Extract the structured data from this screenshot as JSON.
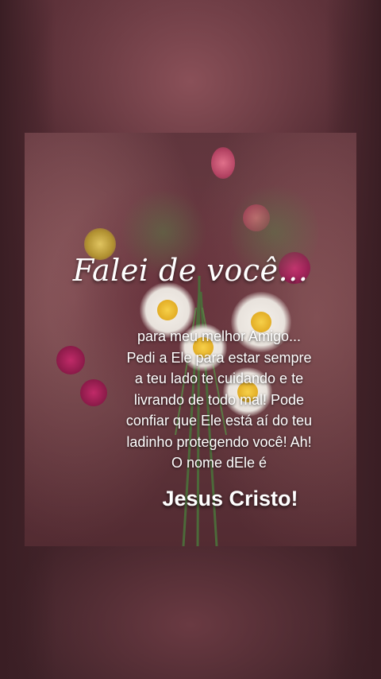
{
  "image": {
    "subject": "flower-bouquet",
    "colors": {
      "background": "#4a2a30",
      "card": "#7e4a50",
      "daisy_petal": "#f4f0ea",
      "daisy_center": "#e8b828",
      "bloom": "#b02a5a",
      "text": "#ffffff"
    }
  },
  "message": {
    "headline": "Falei de você...",
    "lines": [
      "para meu melhor Amigo...",
      "Pedi a Ele para estar sempre",
      "a teu lado te cuidando e te",
      "livrando de todo mal! Pode",
      "confiar que Ele está aí do teu",
      "ladinho protegendo você! Ah!",
      "O nome dEle é"
    ],
    "signature": "Jesus Cristo!"
  }
}
